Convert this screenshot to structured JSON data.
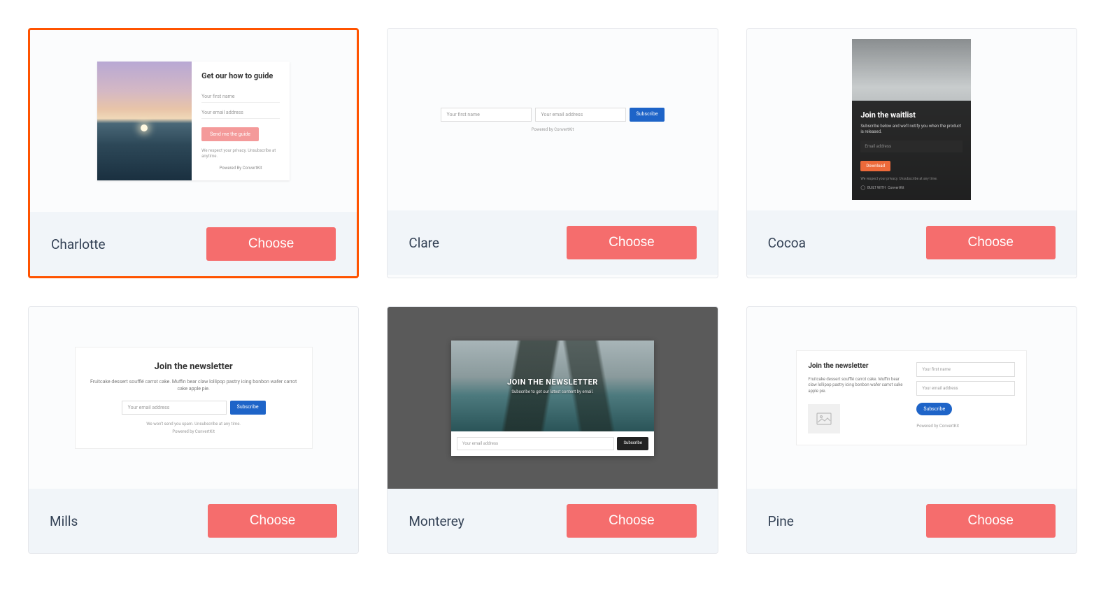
{
  "choose_label": "Choose",
  "templates": [
    {
      "name": "Charlotte",
      "selected": true,
      "preview": {
        "title": "Get our how to guide",
        "name_placeholder": "Your first name",
        "email_placeholder": "Your email address",
        "button": "Send me the guide",
        "privacy": "We respect your privacy. Unsubscribe at anytime.",
        "powered": "Powered By ConvertKit"
      }
    },
    {
      "name": "Clare",
      "selected": false,
      "preview": {
        "name_placeholder": "Your first name",
        "email_placeholder": "Your email address",
        "button": "Subscribe",
        "powered": "Powered by ConvertKit"
      }
    },
    {
      "name": "Cocoa",
      "selected": false,
      "preview": {
        "title": "Join the waitlist",
        "subtitle": "Subscribe below and we'll notify you when the product is released.",
        "email_placeholder": "Email address",
        "button": "Download",
        "privacy": "We respect your privacy. Unsubscribe at any time.",
        "powered": "ConvertKit",
        "built_with": "BUILT WITH"
      }
    },
    {
      "name": "Mills",
      "selected": false,
      "preview": {
        "title": "Join the newsletter",
        "desc": "Fruitcake dessert soufflé carrot cake. Muffin bear claw lollipop pastry icing bonbon wafer carrot cake apple pie.",
        "email_placeholder": "Your email address",
        "button": "Subscribe",
        "privacy": "We won't send you spam. Unsubscribe at any time.",
        "powered": "Powered by ConvertKit"
      }
    },
    {
      "name": "Monterey",
      "selected": false,
      "preview": {
        "title": "JOIN THE NEWSLETTER",
        "subtitle": "Subscribe to get our latest content by email.",
        "email_placeholder": "Your email address",
        "button": "Subscribe"
      }
    },
    {
      "name": "Pine",
      "selected": false,
      "preview": {
        "title": "Join the newsletter",
        "desc": "Fruitcake dessert soufflé carrot cake. Muffin bear claw lollipop pastry icing bonbon wafer carrot cake apple pie.",
        "name_placeholder": "Your first name",
        "email_placeholder": "Your email address",
        "button": "Subscribe",
        "powered": "Powered by ConvertKit"
      }
    }
  ]
}
